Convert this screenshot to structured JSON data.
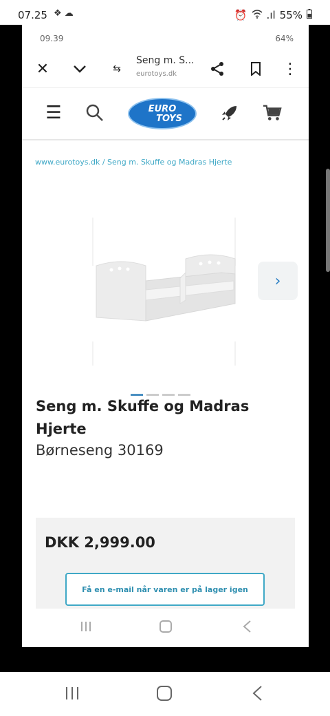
{
  "outer_status": {
    "time": "07.25",
    "left_icons": "❖ ☁",
    "alarm_icon": "alarm-icon",
    "wifi": "wifi-icon",
    "signal": ".ıl",
    "battery": "55%"
  },
  "inner_status": {
    "time": "09.39",
    "battery": "64%"
  },
  "browser": {
    "tab_title": "Seng m. S...",
    "url": "eurotoys.dk"
  },
  "site": {
    "logo_top": "EURO",
    "logo_bottom": "TOYS"
  },
  "breadcrumb": "www.eurotoys.dk / Seng m. Skuffe og Madras Hjerte",
  "carousel": {
    "next_label": "›",
    "dots": 4,
    "active_dot": 0
  },
  "product": {
    "title": "Seng m. Skuffe og Madras Hjerte",
    "subtitle": "Børneseng 30169",
    "price": "DKK 2,999.00",
    "notify_button": "Få en e-mail når varen er på lager igen"
  }
}
